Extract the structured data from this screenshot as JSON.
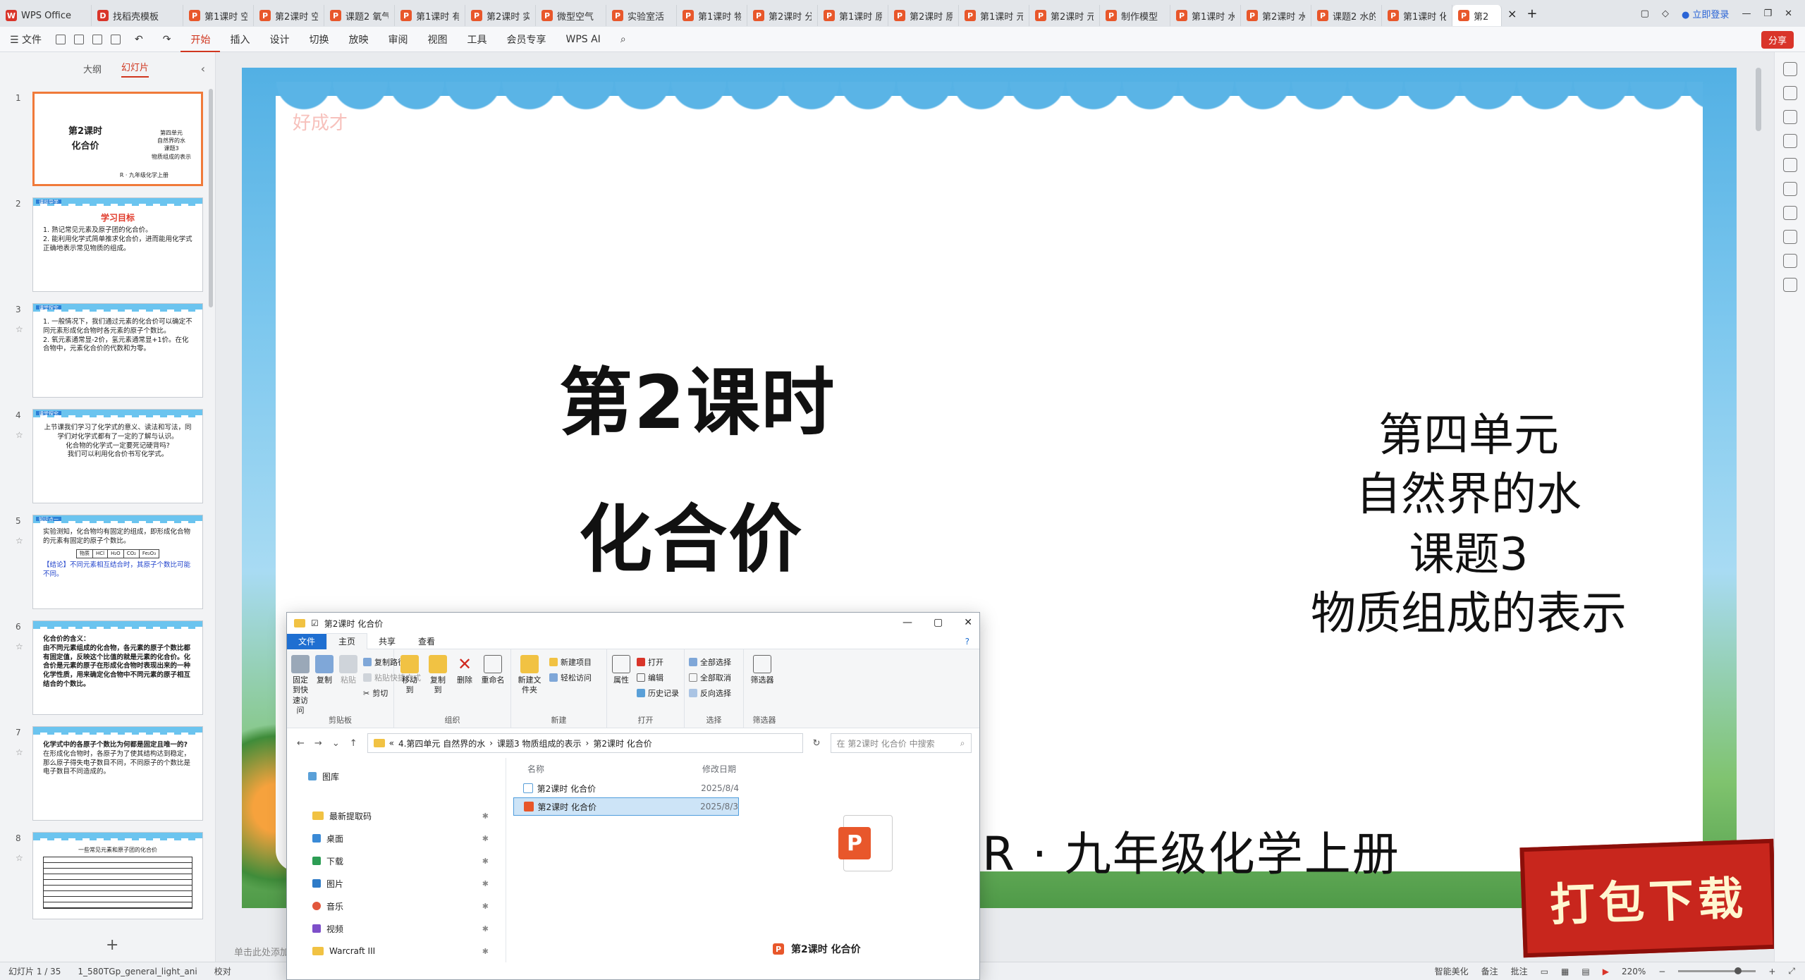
{
  "tabs": [
    {
      "label": "WPS Office",
      "icon": "wps-logo-icon"
    },
    {
      "label": "找稻壳模板",
      "icon": "docer-icon"
    },
    {
      "label": "第1课时 空"
    },
    {
      "label": "第2课时 空"
    },
    {
      "label": "课题2 氧气"
    },
    {
      "label": "第1课时 有"
    },
    {
      "label": "第2课时 实"
    },
    {
      "label": "微型空气"
    },
    {
      "label": "实验室活"
    },
    {
      "label": "第1课时 物"
    },
    {
      "label": "第2课时 分"
    },
    {
      "label": "第1课时 原"
    },
    {
      "label": "第2课时 原"
    },
    {
      "label": "第1课时 元"
    },
    {
      "label": "第2课时 元"
    },
    {
      "label": "制作模型"
    },
    {
      "label": "第1课时 水"
    },
    {
      "label": "第2课时 水"
    },
    {
      "label": "课题2 水的"
    },
    {
      "label": "第1课时 化"
    },
    {
      "label": "第2"
    }
  ],
  "tabbar_right": {
    "login": "立即登录"
  },
  "menu": {
    "file": "文件",
    "items": [
      "开始",
      "插入",
      "设计",
      "切换",
      "放映",
      "审阅",
      "视图",
      "工具",
      "会员专享",
      "WPS AI"
    ],
    "share": "分享"
  },
  "left_panel": {
    "tab_outline": "大纲",
    "tab_slides": "幻灯片"
  },
  "thumbs": [
    {
      "num": "1",
      "title": "第2课时",
      "subtitle": "化合价",
      "side": [
        "第四单元",
        "自然界的水",
        "课题3",
        "物质组成的表示"
      ],
      "foot": "R · 九年级化学上册"
    },
    {
      "num": "2",
      "tag": "课前导学",
      "title": "学习目标",
      "lines": [
        "1. 熟记常见元素及原子团的化合价。",
        "2. 能利用化学式简单推求化合价，进而能用化学式正确地表示常见物质的组成。"
      ]
    },
    {
      "num": "3",
      "tag": "课堂探究",
      "lines": [
        "1. 一般情况下，我们通过元素的化合价可以确定不同元素形成化合物时各元素的原子个数比。",
        "2. 氧元素通常显-2价，氢元素通常显+1价。在化合物中，元素化合价的代数和为零。"
      ]
    },
    {
      "num": "4",
      "tag": "课堂探究",
      "lines": [
        "上节课我们学习了化学式的意义、读法和写法，同学们对化学式都有了一定的了解与认识。",
        "化合物的化学式一定要死记硬背吗?",
        "我们可以利用化合价书写化学式。"
      ]
    },
    {
      "num": "5",
      "tag": "知识点一",
      "lines": [
        "实验测知，化合物均有固定的组成，即形成化合物的元素有固定的原子个数比。"
      ],
      "table": [
        "物质",
        "HCl",
        "H₂O",
        "CO₂",
        "Fe₂O₃"
      ],
      "note": "【结论】不同元素相互结合时，其原子个数比可能不同。"
    },
    {
      "num": "6",
      "lines": [
        "化合价的含义：",
        "由不同元素组成的化合物，各元素的原子个数比都有固定值，反映这个比值的就是元素的化合价。化合价是元素的原子在形成化合物时表现出来的一种化学性质，用来确定化合物中不同元素的原子相互结合的个数比。"
      ]
    },
    {
      "num": "7",
      "lines": [
        "化学式中的各原子个数比为何都是固定且唯一的?",
        "在形成化合物时，各原子为了使其结构达到稳定，那么原子得失电子数目不同，不同原子的个数比是电子数目不同造成的。"
      ]
    },
    {
      "num": "8",
      "title": "一些常见元素和原子团的化合价"
    }
  ],
  "slide": {
    "watermark": "好成才",
    "title_line1": "第2课时",
    "title_line2": "化合价",
    "right_lines": [
      "第四单元",
      "自然界的水",
      "课题3",
      "物质组成的表示"
    ],
    "footer": "R · 九年级化学上册",
    "stamp": "打包下载",
    "notes_placeholder": "单击此处添加备注"
  },
  "explorer": {
    "title": "第2课时 化合价",
    "ribbon_tabs": [
      "文件",
      "主页",
      "共享",
      "查看"
    ],
    "groups": {
      "clipboard": {
        "label": "剪贴板",
        "pin": "固定到快速访问",
        "copy": "复制",
        "paste": "粘贴",
        "copy_path": "复制路径",
        "paste_shortcut": "粘贴快捷方式",
        "cut": "剪切"
      },
      "organize": {
        "label": "组织",
        "move": "移动到",
        "copy_to": "复制到",
        "delete": "删除",
        "rename": "重命名"
      },
      "new": {
        "label": "新建",
        "new_folder": "新建文件夹",
        "new_item": "新建项目",
        "easy_access": "轻松访问"
      },
      "open": {
        "label": "打开",
        "properties": "属性",
        "open": "打开",
        "edit": "编辑",
        "history": "历史记录"
      },
      "select": {
        "label": "选择",
        "all": "全部选择",
        "none": "全部取消",
        "invert": "反向选择"
      },
      "filter": {
        "label": "筛选器",
        "btn": "筛选器"
      }
    },
    "address": [
      "«",
      "4.第四单元 自然界的水",
      "›",
      "课题3 物质组成的表示",
      "›",
      "第2课时 化合价"
    ],
    "search_placeholder": "在 第2课时 化合价 中搜索",
    "nav": [
      "图库",
      "最新提取码",
      "桌面",
      "下载",
      "图片",
      "音乐",
      "视频",
      "Warcraft III"
    ],
    "columns": {
      "name": "名称",
      "date": "修改日期"
    },
    "files": [
      {
        "name": "第2课时 化合价",
        "date": "2025/8/4",
        "selected": false
      },
      {
        "name": "第2课时 化合价",
        "date": "2025/8/3",
        "selected": true
      }
    ],
    "preview_name": "第2课时 化合价"
  },
  "status": {
    "left": "幻灯片 1 / 35",
    "theme": "1_580TGp_general_light_ani",
    "proof": "校对",
    "beautify": "智能美化",
    "notes": "备注",
    "comments": "批注",
    "zoom": "220%"
  }
}
